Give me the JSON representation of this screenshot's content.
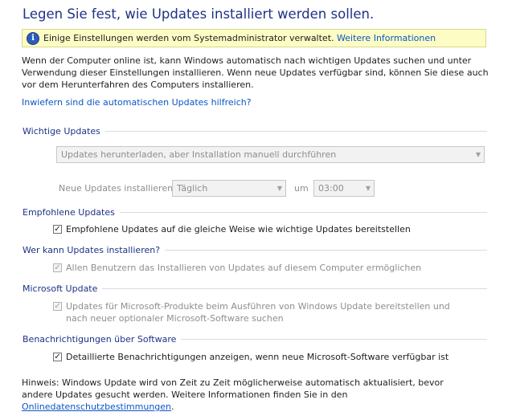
{
  "title": "Legen Sie fest, wie Updates installiert werden sollen.",
  "infobar": {
    "icon": "info-icon",
    "text": "Einige Einstellungen werden vom Systemadministrator verwaltet.",
    "link": "Weitere Informationen"
  },
  "intro": "Wenn der Computer online ist, kann Windows automatisch nach wichtigen Updates suchen und unter Verwendung dieser Einstellungen installieren. Wenn neue Updates verfügbar sind, können Sie diese auch vor dem Herunterfahren des Computers installieren.",
  "help_link": "Inwiefern sind die automatischen Updates hilfreich?",
  "important": {
    "header": "Wichtige Updates",
    "mode_value": "Updates herunterladen, aber Installation manuell durchführen",
    "install_label": "Neue Updates installieren:",
    "day_value": "Täglich",
    "at_label": "um",
    "time_value": "03:00"
  },
  "recommended": {
    "header": "Empfohlene Updates",
    "checkbox_label": "Empfohlene Updates auf die gleiche Weise wie wichtige Updates bereitstellen",
    "checked": true
  },
  "who": {
    "header": "Wer kann Updates installieren?",
    "checkbox_label": "Allen Benutzern das Installieren von Updates auf diesem Computer ermöglichen",
    "checked": true
  },
  "microsoft_update": {
    "header": "Microsoft Update",
    "checkbox_label": "Updates für Microsoft-Produkte beim Ausführen von Windows Update bereitstellen und nach neuer optionaler Microsoft-Software suchen",
    "checked": true
  },
  "software_notifications": {
    "header": "Benachrichtigungen über Software",
    "checkbox_label": "Detaillierte Benachrichtigungen anzeigen, wenn neue Microsoft-Software verfügbar ist",
    "checked": true
  },
  "footer": {
    "text": "Hinweis: Windows Update wird von Zeit zu Zeit möglicherweise automatisch aktualisiert, bevor andere Updates gesucht werden. Weitere Informationen finden Sie in den",
    "link": "Onlinedatenschutzbestimmungen",
    "end": "."
  }
}
